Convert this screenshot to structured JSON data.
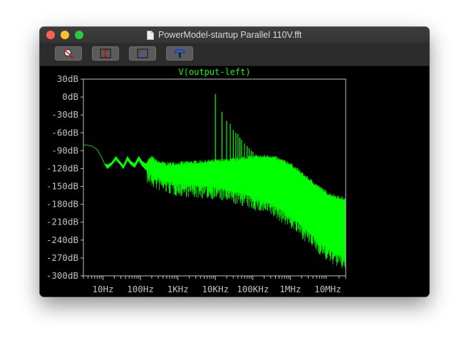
{
  "window": {
    "title": "PowerModel-startup Parallel 110V.fft"
  },
  "toolbar": {
    "buttons": [
      {
        "name": "zoom-cancel",
        "icon": "zoom-cancel-icon"
      },
      {
        "name": "autorange-y",
        "icon": "autorange-y-icon"
      },
      {
        "name": "zoom-to-fit",
        "icon": "zoom-to-fit-icon"
      },
      {
        "name": "place-cursor",
        "icon": "hammer-icon"
      }
    ]
  },
  "colors": {
    "trace": "#00ff00",
    "axis": "#c0c0c0",
    "background": "#000000"
  },
  "chart_data": {
    "type": "line",
    "title": "V(output-left)",
    "xlabel": "",
    "ylabel": "",
    "x_scale": "log",
    "xlim": [
      3,
      30000000
    ],
    "ylim": [
      -300,
      30
    ],
    "grid": false,
    "x_ticks": [
      "10Hz",
      "100Hz",
      "1KHz",
      "10KHz",
      "100KHz",
      "1MHz",
      "10MHz"
    ],
    "x_tick_values": [
      10,
      100,
      1000,
      10000,
      100000,
      1000000,
      10000000
    ],
    "y_ticks": [
      "30dB",
      "0dB",
      "-30dB",
      "-60dB",
      "-90dB",
      "-120dB",
      "-150dB",
      "-180dB",
      "-210dB",
      "-240dB",
      "-270dB",
      "-300dB"
    ],
    "y_tick_values": [
      30,
      0,
      -30,
      -60,
      -90,
      -120,
      -150,
      -180,
      -210,
      -240,
      -270,
      -300
    ],
    "series": [
      {
        "name": "V(output-left)",
        "color": "#00ff00",
        "upper_envelope": [
          [
            3,
            -80
          ],
          [
            5,
            -82
          ],
          [
            7,
            -88
          ],
          [
            9,
            -100
          ],
          [
            11,
            -112
          ],
          [
            13,
            -114
          ],
          [
            17,
            -110
          ],
          [
            22,
            -100
          ],
          [
            28,
            -108
          ],
          [
            35,
            -115
          ],
          [
            45,
            -100
          ],
          [
            55,
            -108
          ],
          [
            70,
            -112
          ],
          [
            90,
            -100
          ],
          [
            110,
            -108
          ],
          [
            140,
            -112
          ],
          [
            200,
            -104
          ],
          [
            300,
            -112
          ],
          [
            500,
            -115
          ],
          [
            1000,
            -114
          ],
          [
            3000,
            -112
          ],
          [
            10000,
            -110
          ],
          [
            30000,
            -108
          ],
          [
            60000,
            -105
          ],
          [
            100000,
            -104
          ],
          [
            300000,
            -102
          ],
          [
            1000000,
            -115
          ],
          [
            3000000,
            -140
          ],
          [
            10000000,
            -165
          ],
          [
            30000000,
            -175
          ]
        ],
        "lower_envelope": [
          [
            3,
            -80
          ],
          [
            5,
            -82
          ],
          [
            7,
            -88
          ],
          [
            9,
            -100
          ],
          [
            11,
            -112
          ],
          [
            13,
            -120
          ],
          [
            17,
            -114
          ],
          [
            22,
            -105
          ],
          [
            28,
            -112
          ],
          [
            35,
            -120
          ],
          [
            45,
            -106
          ],
          [
            55,
            -113
          ],
          [
            70,
            -118
          ],
          [
            90,
            -106
          ],
          [
            110,
            -115
          ],
          [
            140,
            -122
          ],
          [
            200,
            -130
          ],
          [
            300,
            -135
          ],
          [
            500,
            -140
          ],
          [
            1000,
            -145
          ],
          [
            3000,
            -148
          ],
          [
            10000,
            -150
          ],
          [
            30000,
            -158
          ],
          [
            60000,
            -162
          ],
          [
            100000,
            -168
          ],
          [
            300000,
            -178
          ],
          [
            1000000,
            -198
          ],
          [
            3000000,
            -225
          ],
          [
            10000000,
            -255
          ],
          [
            30000000,
            -270
          ]
        ],
        "spikes": [
          {
            "x": 10000,
            "y": 5
          },
          {
            "x": 15000,
            "y": -25
          },
          {
            "x": 20000,
            "y": -40
          },
          {
            "x": 25000,
            "y": -45
          },
          {
            "x": 30000,
            "y": -55
          },
          {
            "x": 35000,
            "y": -60
          },
          {
            "x": 40000,
            "y": -62
          },
          {
            "x": 45000,
            "y": -68
          },
          {
            "x": 50000,
            "y": -72
          },
          {
            "x": 60000,
            "y": -78
          },
          {
            "x": 70000,
            "y": -82
          },
          {
            "x": 80000,
            "y": -86
          },
          {
            "x": 90000,
            "y": -90
          },
          {
            "x": 100000,
            "y": -92
          },
          {
            "x": 120000,
            "y": -96
          },
          {
            "x": 140000,
            "y": -100
          }
        ]
      }
    ]
  }
}
